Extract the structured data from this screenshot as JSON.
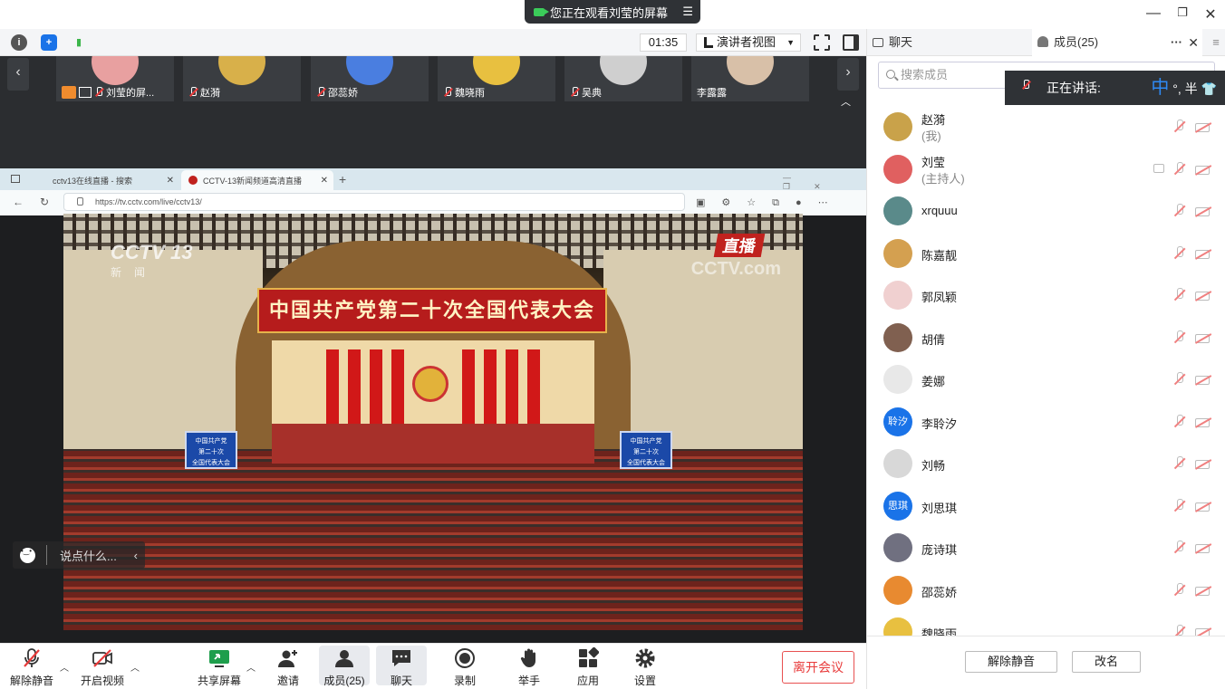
{
  "window": {
    "share_notice": "您正在观看刘莹的屏幕",
    "controls": [
      "—",
      "❐",
      "✕"
    ]
  },
  "toolbar": {
    "timer": "01:35",
    "view_mode": "演讲者视图"
  },
  "thumbnails": [
    {
      "name": "刘莹的屏...",
      "color": "#e8a0a0"
    },
    {
      "name": "赵漪",
      "color": "#d8b04a"
    },
    {
      "name": "邵蕊娇",
      "color": "#4a7ee0"
    },
    {
      "name": "魏晓雨",
      "color": "#e8c040"
    },
    {
      "name": "吴典",
      "color": "#cfcfcf"
    },
    {
      "name": "李露露",
      "color": "#d8c0a8"
    }
  ],
  "browser": {
    "tabs": [
      {
        "title": "cctv13在线直播 - 搜索"
      },
      {
        "title": "CCTV-13新闻频道高清直播"
      }
    ],
    "url": "https://tv.cctv.com/live/cctv13/"
  },
  "video": {
    "banner": "中国共产党第二十次全国代表大会",
    "live_badge": "直播",
    "logo": "CCTV 13",
    "logo_sub": "新闻",
    "watermark": "CCTV.com",
    "sign_text": [
      "中国共产党",
      "第二十次",
      "全国代表大会"
    ]
  },
  "comment": {
    "placeholder": "说点什么..."
  },
  "bottom_bar": [
    {
      "label": "解除静音"
    },
    {
      "label": "开启视频"
    },
    {
      "label": "共享屏幕"
    },
    {
      "label": "邀请"
    },
    {
      "label": "成员(25)"
    },
    {
      "label": "聊天"
    },
    {
      "label": "录制"
    },
    {
      "label": "举手"
    },
    {
      "label": "应用"
    },
    {
      "label": "设置"
    }
  ],
  "leave_button": "离开会议",
  "right_panel": {
    "tabs": [
      {
        "label": "聊天"
      },
      {
        "label": "成员(25)"
      }
    ],
    "search_placeholder": "搜索成员",
    "speaking_label": "正在讲话:",
    "ime_text": "中",
    "ime_extra": "°, 半",
    "members": [
      {
        "name": "赵漪",
        "role": "(我)",
        "avatar_color": "#c9a24a",
        "avatar_text": ""
      },
      {
        "name": "刘莹",
        "role": "(主持人)",
        "avatar_color": "#e06060",
        "avatar_text": ""
      },
      {
        "name": "xrquuu",
        "role": "",
        "avatar_color": "#5a8a8a",
        "avatar_text": ""
      },
      {
        "name": "陈嘉靓",
        "role": "",
        "avatar_color": "#d4a050",
        "avatar_text": ""
      },
      {
        "name": "郭凤颖",
        "role": "",
        "avatar_color": "#f0d0d0",
        "avatar_text": ""
      },
      {
        "name": "胡倩",
        "role": "",
        "avatar_color": "#806050",
        "avatar_text": ""
      },
      {
        "name": "姜娜",
        "role": "",
        "avatar_color": "#e8e8e8",
        "avatar_text": ""
      },
      {
        "name": "李聆汐",
        "role": "",
        "avatar_color": "#1a73e8",
        "avatar_text": "聆汐"
      },
      {
        "name": "刘畅",
        "role": "",
        "avatar_color": "#d8d8d8",
        "avatar_text": ""
      },
      {
        "name": "刘思琪",
        "role": "",
        "avatar_color": "#1a73e8",
        "avatar_text": "思琪"
      },
      {
        "name": "庞诗琪",
        "role": "",
        "avatar_color": "#707080",
        "avatar_text": ""
      },
      {
        "name": "邵蕊娇",
        "role": "",
        "avatar_color": "#e88a30",
        "avatar_text": ""
      },
      {
        "name": "魏晓雨",
        "role": "",
        "avatar_color": "#e8c040",
        "avatar_text": ""
      }
    ],
    "buttons": {
      "unmute_all": "解除静音",
      "rename": "改名"
    }
  }
}
